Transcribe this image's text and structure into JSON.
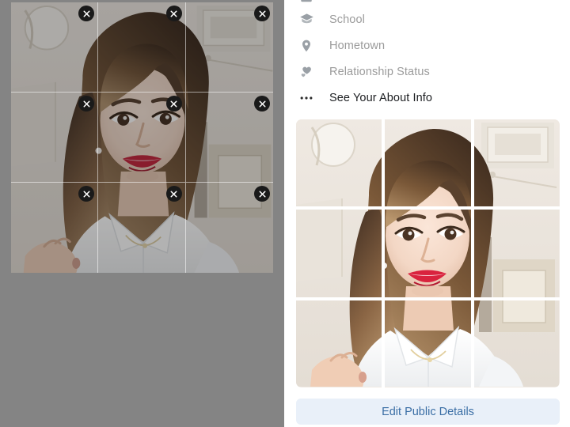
{
  "about": {
    "items": [
      {
        "label": "",
        "icon": "workplace-icon",
        "clipped": true,
        "muted": true
      },
      {
        "label": "School",
        "icon": "graduation-cap-icon",
        "clipped": false,
        "muted": true
      },
      {
        "label": "Hometown",
        "icon": "location-pin-icon",
        "clipped": false,
        "muted": true
      },
      {
        "label": "Relationship Status",
        "icon": "hearts-icon",
        "clipped": false,
        "muted": true
      },
      {
        "label": "See Your About Info",
        "icon": "ellipsis-icon",
        "clipped": false,
        "muted": false
      }
    ]
  },
  "photo_grid": {
    "name": "profile-photo-grid",
    "rows": 3,
    "columns": 3,
    "tile_count": 9,
    "gap_color": "#ffffff",
    "subject": "portrait-photo-of-smiling-woman-in-white-shirt"
  },
  "editor": {
    "name": "photo-grid-editor",
    "backdrop_color": "#848484",
    "rows": 3,
    "columns": 3,
    "tiles": [
      {
        "index": 0,
        "remove_label": "×"
      },
      {
        "index": 1,
        "remove_label": "×"
      },
      {
        "index": 2,
        "remove_label": "×"
      },
      {
        "index": 3,
        "remove_label": "×"
      },
      {
        "index": 4,
        "remove_label": "×"
      },
      {
        "index": 5,
        "remove_label": "×"
      },
      {
        "index": 6,
        "remove_label": "×"
      },
      {
        "index": 7,
        "remove_label": "×"
      },
      {
        "index": 8,
        "remove_label": "×"
      }
    ]
  },
  "actions": {
    "edit_public_details_label": "Edit Public Details"
  },
  "colors": {
    "button_bg": "#e9f0f9",
    "button_text": "#3a6ea5",
    "muted_text": "#9b9b9b",
    "strong_text": "#1c1e21",
    "icon": "#9aa0a6",
    "overlay_backdrop": "#848484"
  }
}
